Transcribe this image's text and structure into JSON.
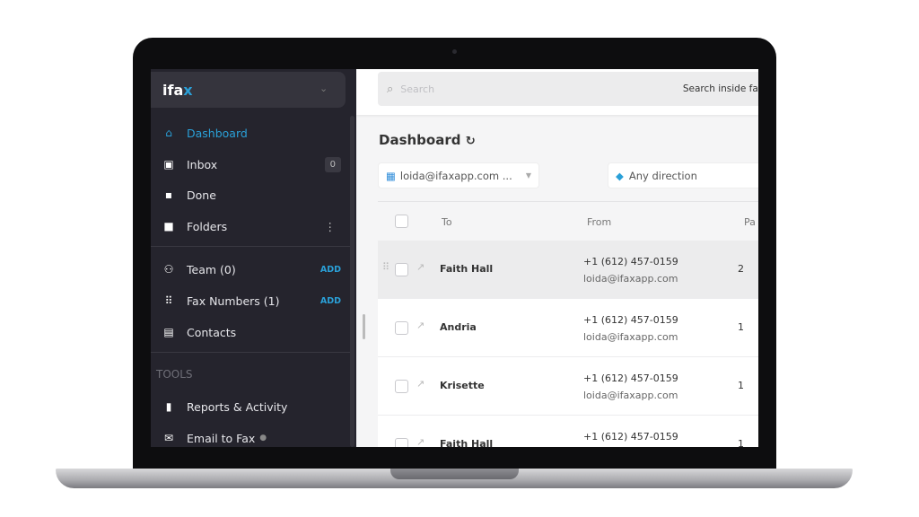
{
  "app": {
    "logo": "ifax"
  },
  "sidebar": {
    "items": [
      {
        "label": "Dashboard",
        "icon": "home-icon",
        "active": true
      },
      {
        "label": "Inbox",
        "icon": "inbox-icon",
        "badge": "0"
      },
      {
        "label": "Done",
        "icon": "done-folder-icon"
      },
      {
        "label": "Folders",
        "icon": "folder-icon"
      },
      {
        "label": "Team (0)",
        "icon": "team-icon",
        "action": "ADD"
      },
      {
        "label": "Fax Numbers (1)",
        "icon": "dialpad-icon",
        "action": "ADD"
      },
      {
        "label": "Contacts",
        "icon": "contact-icon"
      },
      {
        "label": "Reports & Activity",
        "icon": "bar-chart-icon"
      },
      {
        "label": "Email to Fax",
        "icon": "mail-icon"
      }
    ],
    "section_tools": "TOOLS"
  },
  "search": {
    "placeholder": "Search",
    "inside_label": "Search inside fax"
  },
  "main": {
    "title": "Dashboard",
    "filters": {
      "account": "loida@ifaxapp.com ...",
      "direction": "Any direction"
    },
    "columns": [
      "To",
      "From",
      "Pa"
    ],
    "rows": [
      {
        "to": "Faith Hall",
        "phone": "+1 (612) 457-0159",
        "email": "loida@ifaxapp.com",
        "pages": "2"
      },
      {
        "to": "Andria",
        "phone": "+1 (612) 457-0159",
        "email": "loida@ifaxapp.com",
        "pages": "1"
      },
      {
        "to": "Krisette",
        "phone": "+1 (612) 457-0159",
        "email": "loida@ifaxapp.com",
        "pages": "1"
      },
      {
        "to": "Faith Hall",
        "phone": "+1 (612) 457-0159",
        "email": "",
        "pages": "1"
      }
    ]
  },
  "colors": {
    "sidebar_bg": "#25242d",
    "accent": "#2aa0d8"
  }
}
